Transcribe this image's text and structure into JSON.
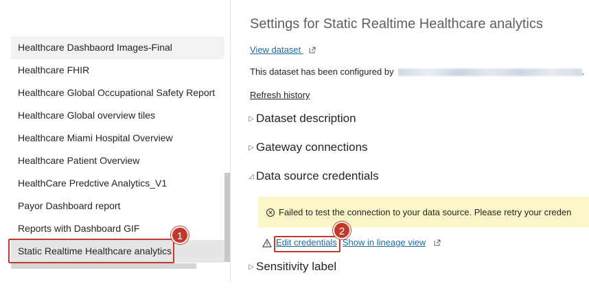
{
  "datasets": {
    "items": [
      "Healthcare Dashbaord Images-Final",
      "Healthcare FHIR",
      "Healthcare Global Occupational Safety Report",
      "Healthcare Global overview tiles",
      "Healthcare Miami Hospital Overview",
      "Healthcare Patient Overview",
      "HealthCare Predctive Analytics_V1",
      "Payor Dashboard report",
      "Reports with Dashboard GIF",
      "Static Realtime Healthcare analytics"
    ],
    "selected_index": 9
  },
  "settings": {
    "title": "Settings for Static Realtime Healthcare analytics",
    "view_dataset": "View dataset",
    "configured_by": "This dataset has been configured by",
    "configured_by_suffix": ".",
    "refresh_history": "Refresh history"
  },
  "sections": {
    "dataset_description": "Dataset description",
    "gateway_connections": "Gateway connections",
    "data_source_credentials": "Data source credentials",
    "sensitivity_label": "Sensitivity label"
  },
  "credentials": {
    "error_message": "Failed to test the connection to your data source. Please retry your creden",
    "edit_credentials": "Edit credentials",
    "show_lineage": "Show in lineage view"
  },
  "callouts": {
    "one": "1",
    "two": "2"
  },
  "colors": {
    "accent_link": "#1f6aa3",
    "callout": "#c0392b",
    "warning_bg": "#fbf6c8",
    "selected_bg": "#e6e6e6"
  },
  "icons": {
    "external": "external-link-icon",
    "collapsed": "chevron-right-icon",
    "expanded": "chevron-down-icon",
    "error": "error-circle-icon",
    "warning": "warning-triangle-icon"
  }
}
